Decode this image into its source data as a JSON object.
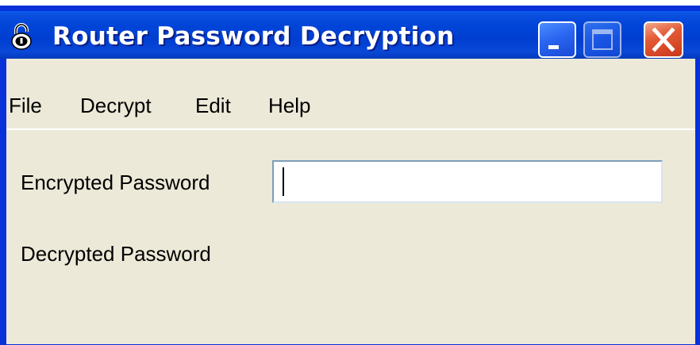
{
  "window": {
    "title": "Router Password Decryption",
    "icon": "padlock-icon",
    "controls": [
      "minimize-icon",
      "maximize-icon",
      "close-icon"
    ]
  },
  "menu": {
    "items": [
      {
        "label": "File"
      },
      {
        "label": "Decrypt"
      },
      {
        "label": "Edit"
      },
      {
        "label": "Help"
      }
    ]
  },
  "form": {
    "encrypted_label": "Encrypted Password",
    "encrypted_value": "",
    "decrypted_label": "Decrypted Password"
  },
  "colors": {
    "titlebar": "#0045d8",
    "client_bg": "#ece9d8",
    "close_button": "#e45a35"
  }
}
